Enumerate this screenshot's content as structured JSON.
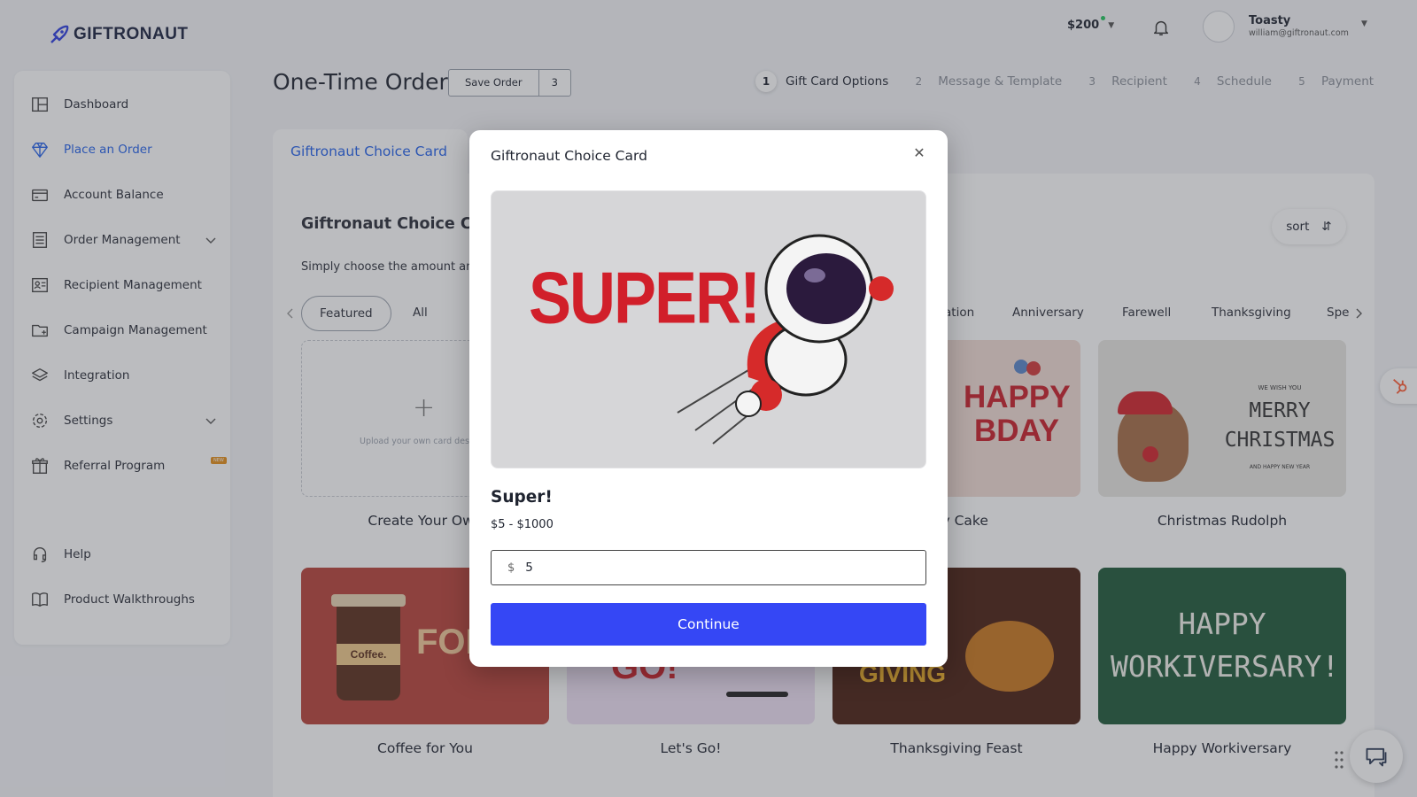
{
  "header": {
    "brand": "GIFTRONAUT",
    "balance": "$200",
    "user_name": "Toasty",
    "user_email": "william@giftronaut.com"
  },
  "sidebar": {
    "items": [
      {
        "label": "Dashboard",
        "icon": "dashboard-icon"
      },
      {
        "label": "Place an Order",
        "icon": "diamond-icon",
        "active": true
      },
      {
        "label": "Account Balance",
        "icon": "card-icon"
      },
      {
        "label": "Order Management",
        "icon": "list-icon",
        "expandable": true
      },
      {
        "label": "Recipient Management",
        "icon": "contacts-icon"
      },
      {
        "label": "Campaign Management",
        "icon": "folder-icon"
      },
      {
        "label": "Integration",
        "icon": "layers-icon"
      },
      {
        "label": "Settings",
        "icon": "gear-icon",
        "expandable": true
      },
      {
        "label": "Referral Program",
        "icon": "gift-icon",
        "badge": "NEW"
      },
      {
        "label": "Help",
        "icon": "headset-icon"
      },
      {
        "label": "Product Walkthroughs",
        "icon": "book-icon"
      }
    ]
  },
  "main": {
    "title": "One-Time Order",
    "save_label": "Save Order",
    "save_count": "3",
    "steps": [
      {
        "num": "1",
        "label": "Gift Card Options",
        "active": true
      },
      {
        "num": "2",
        "label": "Message & Template"
      },
      {
        "num": "3",
        "label": "Recipient"
      },
      {
        "num": "4",
        "label": "Schedule"
      },
      {
        "num": "5",
        "label": "Payment"
      }
    ],
    "card_tab": "Giftronaut Choice Card",
    "section_title": "Giftronaut Choice Card",
    "section_sub": "Simply choose the amount and",
    "sort_label": "sort",
    "tabs": [
      "Featured",
      "All",
      "ation",
      "Anniversary",
      "Farewell",
      "Thanksgiving",
      "Spe"
    ],
    "upload_text": "Upload your own card design",
    "tiles": [
      {
        "label": "Create Your Own"
      },
      {
        "label": "day Cake",
        "art": "HAPPY BDAY"
      },
      {
        "label": "Christmas Rudolph",
        "art_small": "WE WISH YOU",
        "art": "MERRY CHRISTMAS",
        "art_foot": "AND HAPPY NEW YEAR"
      },
      {
        "label": "Coffee for You",
        "art": "FOR",
        "cup": "Coffee."
      },
      {
        "label": "Let's Go!",
        "art": "GO!"
      },
      {
        "label": "Thanksgiving Feast",
        "art": "GIVING"
      },
      {
        "label": "Happy Workiversary",
        "art": "HAPPY WORKIVERSARY!"
      }
    ]
  },
  "modal": {
    "title": "Giftronaut Choice Card",
    "image_text": "SUPER!",
    "card_name": "Super!",
    "range": "$5 - $1000",
    "currency": "$",
    "amount": "5",
    "continue_label": "Continue"
  },
  "colors": {
    "accent": "#2563eb",
    "primary_button": "#3547f5",
    "overlay": "rgba(60,63,72,0.35)"
  }
}
